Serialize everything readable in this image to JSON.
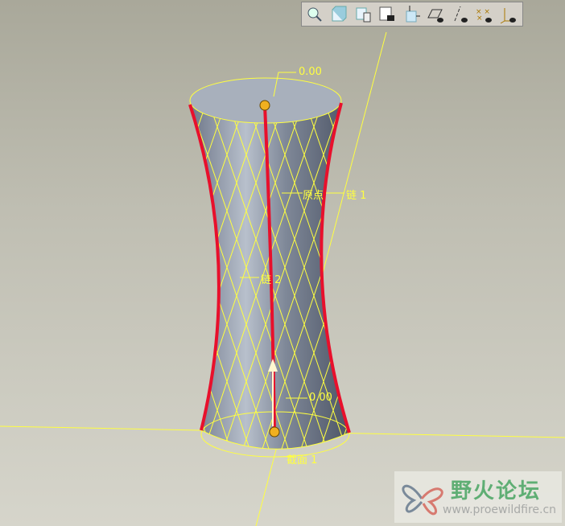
{
  "toolbar": {
    "items": [
      {
        "name": "zoom-icon"
      },
      {
        "name": "view-box-icon"
      },
      {
        "name": "view-manager-icon"
      },
      {
        "name": "table-camera-icon"
      },
      {
        "name": "orient-icon"
      },
      {
        "name": "plane-display-icon"
      },
      {
        "name": "axis-display-icon"
      },
      {
        "name": "point-display-icon"
      },
      {
        "name": "csys-display-icon"
      }
    ]
  },
  "labels": {
    "top_value": "0.00",
    "origin": "原点",
    "chain1": "链 1",
    "chain2": "链 2",
    "bottom_value": "0.00",
    "section": "截面 1"
  },
  "watermark": {
    "title": "野火论坛",
    "url": "www.proewildfire.cn"
  },
  "colors": {
    "trajectory": "#e8102c",
    "wire": "#ffff40",
    "background": "#bfbeb2"
  }
}
